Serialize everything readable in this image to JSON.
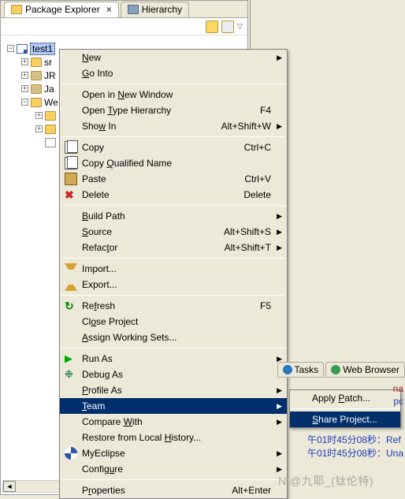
{
  "tabs": {
    "packageExplorer": "Package Explorer",
    "hierarchy": "Hierarchy"
  },
  "tree": {
    "project": "test1",
    "nodes": [
      "sr",
      "JR",
      "Ja",
      "We"
    ]
  },
  "menu": {
    "new": "New",
    "goInto": "Go Into",
    "openNewWindow": "Open in New Window",
    "openTypeHierarchy": "Open Type Hierarchy",
    "scF4": "F4",
    "showIn": "Show In",
    "scShowIn": "Alt+Shift+W",
    "copy": "Copy",
    "scCopy": "Ctrl+C",
    "copyQN": "Copy Qualified Name",
    "paste": "Paste",
    "scPaste": "Ctrl+V",
    "delete": "Delete",
    "scDelete": "Delete",
    "buildPath": "Build Path",
    "source": "Source",
    "scSource": "Alt+Shift+S",
    "refactor": "Refactor",
    "scRefactor": "Alt+Shift+T",
    "import": "Import...",
    "export": "Export...",
    "refresh": "Refresh",
    "scRefresh": "F5",
    "closeProject": "Close Project",
    "assignWS": "Assign Working Sets...",
    "runAs": "Run As",
    "debugAs": "Debug As",
    "profileAs": "Profile As",
    "team": "Team",
    "compareWith": "Compare With",
    "restore": "Restore from Local History...",
    "myeclipse": "MyEclipse",
    "configure": "Configure",
    "properties": "Properties",
    "scProperties": "Alt+Enter"
  },
  "submenu": {
    "applyPatch": "Apply Patch...",
    "shareProject": "Share Project..."
  },
  "rightTabs": {
    "tasks": "Tasks",
    "webBrowser": "Web Browser"
  },
  "console": {
    "l1a": "午01时45分08秒：",
    "l1b": "Ref",
    "l2a": "午01时45分08秒：",
    "l2b": "Una",
    "pre": "na",
    "prec": "pc"
  },
  "watermark": "N @九耶_(钛伦特)"
}
